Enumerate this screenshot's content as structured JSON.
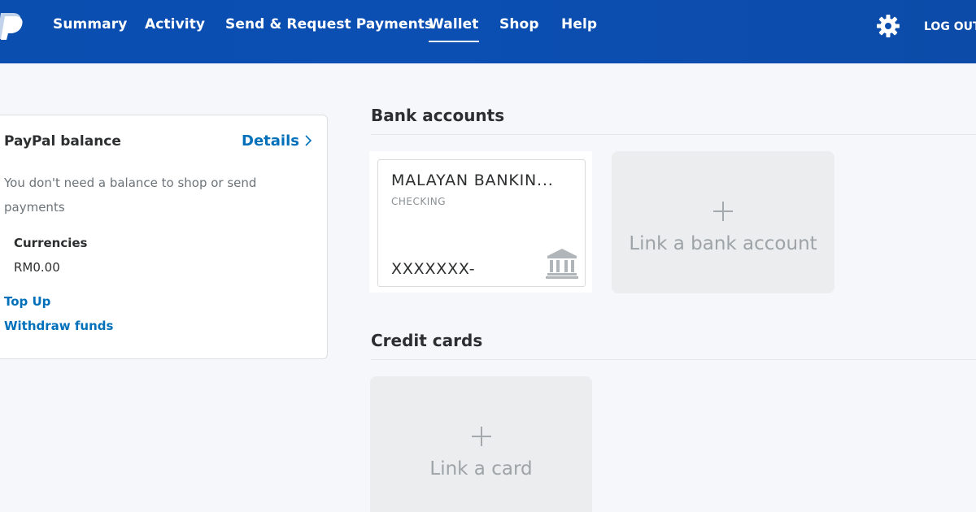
{
  "nav": {
    "items": [
      {
        "label": "Summary"
      },
      {
        "label": "Activity"
      },
      {
        "label": "Send & Request Payments"
      },
      {
        "label": "Wallet",
        "active": true
      },
      {
        "label": "Shop"
      },
      {
        "label": "Help"
      }
    ],
    "logout_label": "LOG OUT",
    "settings_icon": "gear-icon",
    "logo_icon": "paypal-logo"
  },
  "balance": {
    "title": "PayPal balance",
    "details_label": "Details",
    "description": "You don't need a balance to shop or send payments",
    "currencies_label": "Currencies",
    "currency_value": "RM0.00",
    "top_up_label": "Top Up",
    "withdraw_label": "Withdraw funds"
  },
  "bank_accounts": {
    "title": "Bank accounts",
    "account": {
      "name": "MALAYAN BANKIN...",
      "type": "CHECKING",
      "number": "XXXXXXX-",
      "icon": "bank-icon"
    },
    "link_label": "Link a bank account"
  },
  "credit_cards": {
    "title": "Credit cards",
    "link_label": "Link a card"
  },
  "colors": {
    "header": "#0b4fb3",
    "link": "#0070ba",
    "page_bg": "#f5f7fa",
    "tile_bg": "#ebedef"
  }
}
